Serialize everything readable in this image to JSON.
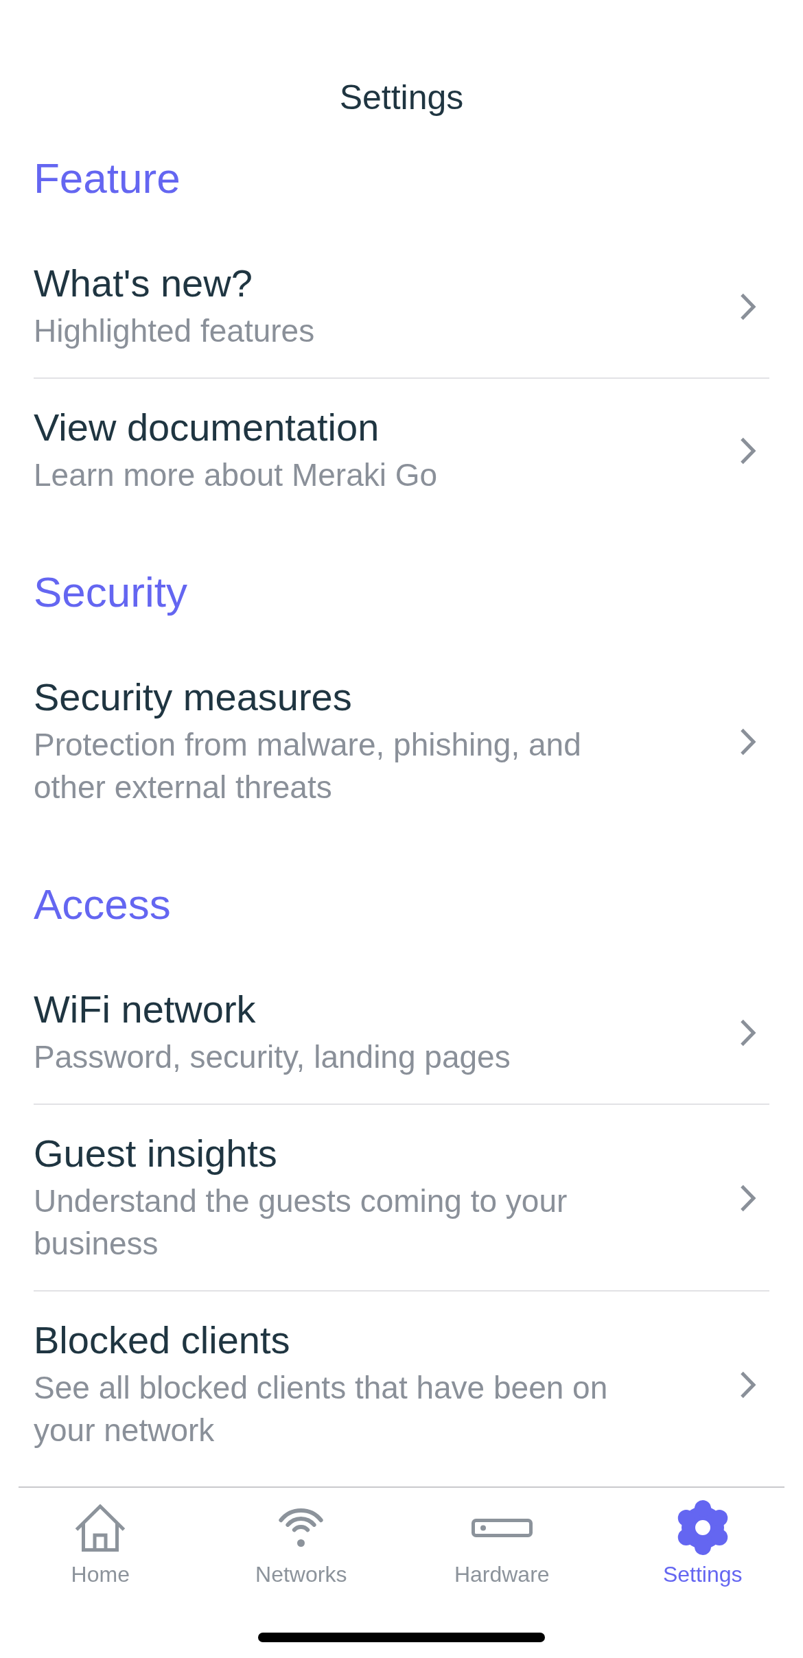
{
  "nav": {
    "title": "Settings"
  },
  "sections": [
    {
      "header": "Feature",
      "rows": [
        {
          "title": "What's new?",
          "subtitle": "Highlighted features"
        },
        {
          "title": "View documentation",
          "subtitle": "Learn more about Meraki Go"
        }
      ]
    },
    {
      "header": "Security",
      "rows": [
        {
          "title": "Security measures",
          "subtitle": "Protection from malware, phishing, and other external threats"
        }
      ]
    },
    {
      "header": "Access",
      "rows": [
        {
          "title": "WiFi network",
          "subtitle": "Password, security, landing pages"
        },
        {
          "title": "Guest insights",
          "subtitle": "Understand the guests coming to your business"
        },
        {
          "title": "Blocked clients",
          "subtitle": "See all blocked clients that have been on your network"
        }
      ]
    }
  ],
  "tab_bar": {
    "tabs": [
      {
        "label": "Home",
        "selected": false
      },
      {
        "label": "Networks",
        "selected": false
      },
      {
        "label": "Hardware",
        "selected": false
      },
      {
        "label": "Settings",
        "selected": true
      }
    ]
  }
}
